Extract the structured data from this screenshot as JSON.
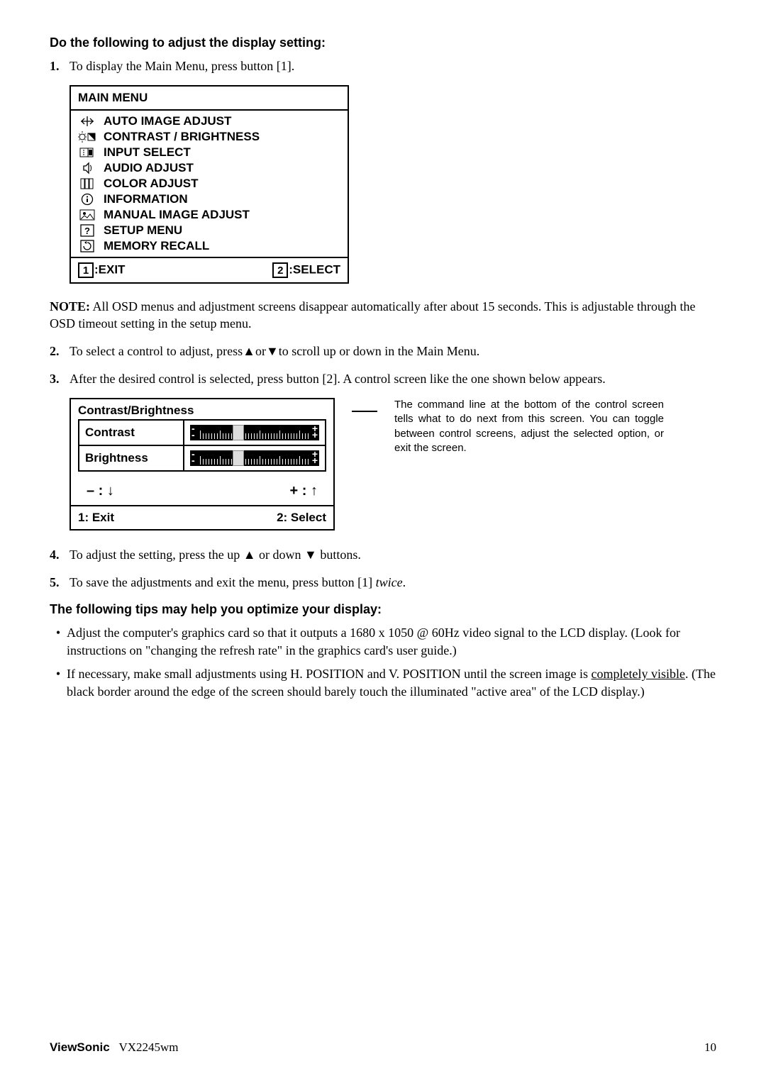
{
  "headings": {
    "h1": "Do the following to adjust the display setting:",
    "h2": "The following tips may help you optimize your display:"
  },
  "steps": {
    "s1": {
      "num": "1.",
      "text": "To display the Main Menu, press button [1]."
    },
    "s2": {
      "num": "2.",
      "text": "To select a control to adjust, press▲or▼to scroll up or down in the Main Menu."
    },
    "s3": {
      "num": "3.",
      "text": "After the desired control is selected, press button [2]. A control screen like the one shown below appears."
    },
    "s4": {
      "num": "4.",
      "text": "To adjust the setting, press the up ▲ or down ▼ buttons."
    },
    "s5": {
      "num": "5.",
      "text_a": "To save the adjustments and exit the menu, press button [1] ",
      "text_b": "twice",
      "text_c": "."
    }
  },
  "note": {
    "label": "NOTE:",
    "text": " All OSD menus and adjustment screens disappear automatically after about 15 seconds. This is adjustable through the OSD timeout setting in the setup menu."
  },
  "main_menu": {
    "title": "MAIN MENU",
    "items": [
      "AUTO IMAGE ADJUST",
      "CONTRAST / BRIGHTNESS",
      "INPUT SELECT",
      "AUDIO ADJUST",
      "COLOR ADJUST",
      "INFORMATION",
      "MANUAL IMAGE ADJUST",
      "SETUP MENU",
      "MEMORY RECALL"
    ],
    "footer": {
      "key1": "1",
      "label1": ":EXIT",
      "key2": "2",
      "label2": ":SELECT"
    }
  },
  "control_panel": {
    "title": "Contrast/Brightness",
    "row1": "Contrast",
    "row2": "Brightness",
    "minus": "– : ",
    "plus": "+ : ",
    "footer_left": "1: Exit",
    "footer_right": "2: Select"
  },
  "callout": "The command line at the bottom of the control screen tells what to do next from this screen. You can toggle between control screens, adjust the selected option, or exit the screen.",
  "tips": {
    "b1": "Adjust the computer's graphics card so that it outputs a 1680 x 1050 @ 60Hz video signal to the LCD display. (Look for instructions on \"changing the refresh rate\" in the graphics card's user guide.)",
    "b2_a": "If necessary, make small adjustments using H. POSITION and V. POSITION until the screen image is ",
    "b2_u": "completely visible",
    "b2_b": ". (The black border around the edge of the screen should barely touch the illuminated \"active area\" of the LCD display.)"
  },
  "footer": {
    "brand": "ViewSonic",
    "model": "VX2245wm",
    "page": "10"
  }
}
